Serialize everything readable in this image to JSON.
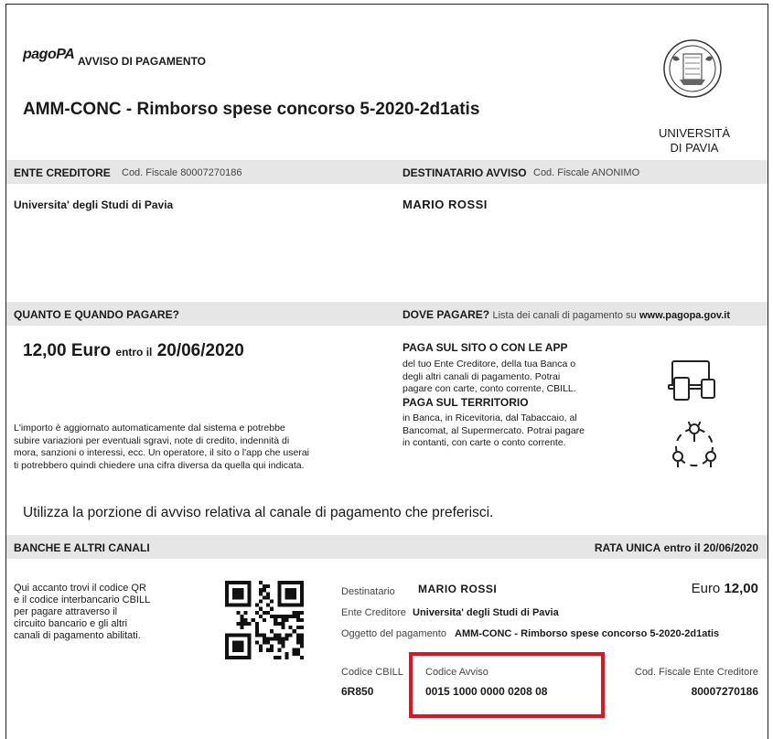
{
  "header": {
    "brand": "pagoPA",
    "notice_label": "AVVISO DI PAGAMENTO",
    "title": "AMM-CONC - Rimborso spese concorso 5-2020-2d1atis",
    "university_line1": "UNIVERSITÀ",
    "university_line2": "DI PAVIA"
  },
  "creditor": {
    "label": "ENTE CREDITORE",
    "fiscal_code": "Cod. Fiscale 80007270186",
    "name": "Universita' degli Studi di Pavia"
  },
  "recipient": {
    "label": "DESTINATARIO AVVISO",
    "fiscal_code": "Cod. Fiscale ANONIMO",
    "name": "MARIO ROSSI"
  },
  "amount_section": {
    "label": "QUANTO E QUANDO PAGARE?",
    "amount": "12,00 Euro",
    "within": "entro il",
    "date": "20/06/2020",
    "note_lines": [
      "L'importo è aggiornato automaticamente dal sistema e potrebbe",
      "subire variazioni per eventuali sgravi, note di credito, indennità di",
      "mora, sanzioni o interessi, ecc. Un operatore, il sito o l'app che userai",
      "ti potrebbero quindi chiedere una cifra diversa da quella qui indicata."
    ]
  },
  "where_section": {
    "label": "DOVE PAGARE?",
    "hint": "Lista dei canali di pagamento su",
    "link": "www.pagopa.gov.it",
    "online_title": "PAGA SUL SITO O CON LE APP",
    "online_lines": [
      "del tuo Ente Creditore, della tua Banca o",
      "degli altri canali di pagamento. Potrai",
      "pagare con carte, conto corrente, CBILL."
    ],
    "territory_title": "PAGA SUL TERRITORIO",
    "territory_lines": [
      "in Banca, in Ricevitoria, dal Tabaccaio, al",
      "Bancomat, al Supermercato. Potrai pagare",
      "in contanti, con carte o conto corrente."
    ]
  },
  "instruction": "Utilizza la porzione di avviso relativa al canale di pagamento che preferisci.",
  "bank_section": {
    "label": "BANCHE E ALTRI CANALI",
    "installment": "RATA UNICA",
    "installment_suffix": "entro il 20/06/2020",
    "qr_text_lines": [
      "Qui accanto trovi il codice QR",
      "e il codice interbancario CBILL",
      "per pagare attraverso il",
      "circuito bancario e gli altri",
      "canali di pagamento abilitati."
    ],
    "recipient_label": "Destinatario",
    "recipient_value": "MARIO ROSSI",
    "euro_label": "Euro",
    "euro_value": "12,00",
    "creditor_label": "Ente Creditore",
    "creditor_value": "Universita' degli Studi di Pavia",
    "object_label": "Oggetto del pagamento",
    "object_value": "AMM-CONC - Rimborso spese concorso 5-2020-2d1atis",
    "cbill_label": "Codice CBILL",
    "cbill_value": "6R850",
    "notice_code_label": "Codice Avviso",
    "notice_code_value": "0015 1000 0000 0208 08",
    "creditor_fc_label": "Cod. Fiscale Ente Creditore",
    "creditor_fc_value": "80007270186"
  },
  "highlight_color": "#e0141e"
}
